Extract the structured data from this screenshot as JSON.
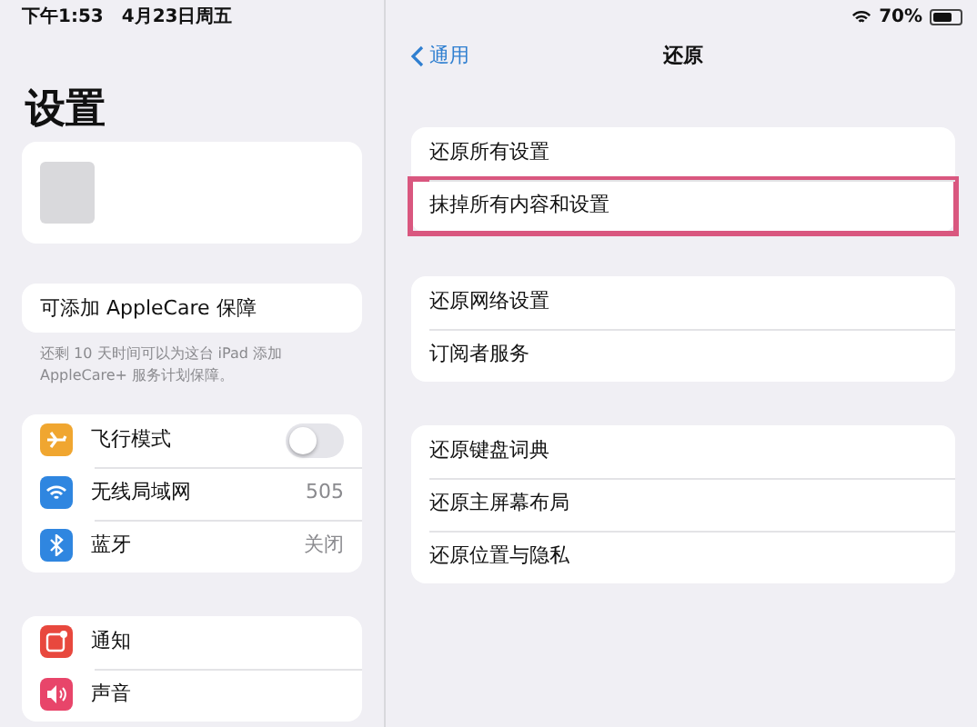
{
  "status_bar": {
    "time": "下午1:53",
    "date": "4月23日周五",
    "battery": "70%"
  },
  "sidebar": {
    "title": "设置",
    "applecare": {
      "label": "可添加 AppleCare 保障",
      "footer": "还剩 10 天时间可以为这台 iPad 添加 AppleCare+ 服务计划保障。"
    },
    "groups": [
      [
        {
          "kind": "toggle",
          "label": "飞行模式",
          "color": "#f0a630",
          "on": false
        },
        {
          "kind": "value",
          "label": "无线局域网",
          "color": "#2f86e0",
          "value": "505"
        },
        {
          "kind": "value",
          "label": "蓝牙",
          "color": "#2f86e0",
          "value": "关闭"
        }
      ],
      [
        {
          "kind": "plain",
          "label": "通知",
          "color": "#e8483e"
        },
        {
          "kind": "plain",
          "label": "声音",
          "color": "#e8456a"
        }
      ]
    ]
  },
  "detail": {
    "back": "通用",
    "title": "还原",
    "groups": [
      [
        {
          "label": "还原所有设置",
          "highlighted": false
        },
        {
          "label": "抹掉所有内容和设置",
          "highlighted": true
        }
      ],
      [
        {
          "label": "还原网络设置",
          "highlighted": false
        },
        {
          "label": "订阅者服务",
          "highlighted": false
        }
      ],
      [
        {
          "label": "还原键盘词典",
          "highlighted": false
        },
        {
          "label": "还原主屏幕布局",
          "highlighted": false
        },
        {
          "label": "还原位置与隐私",
          "highlighted": false
        }
      ]
    ]
  }
}
